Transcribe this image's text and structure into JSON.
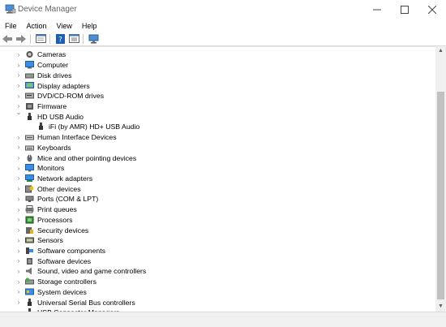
{
  "window": {
    "title": "Device Manager"
  },
  "menu": [
    "File",
    "Action",
    "View",
    "Help"
  ],
  "toolbar": {
    "buttons": [
      "back-arrow-icon",
      "forward-arrow-icon",
      "properties-icon",
      "help-icon",
      "update-driver-icon",
      "scan-hardware-icon"
    ]
  },
  "tree": {
    "items": [
      {
        "label": "Cameras",
        "icon": "camera-icon",
        "expanded": false
      },
      {
        "label": "Computer",
        "icon": "computer-icon",
        "expanded": false
      },
      {
        "label": "Disk drives",
        "icon": "disk-drive-icon",
        "expanded": false
      },
      {
        "label": "Display adapters",
        "icon": "display-adapter-icon",
        "expanded": false
      },
      {
        "label": "DVD/CD-ROM drives",
        "icon": "dvd-icon",
        "expanded": false
      },
      {
        "label": "Firmware",
        "icon": "firmware-icon",
        "expanded": false
      },
      {
        "label": "HD USB Audio",
        "icon": "usb-audio-icon",
        "expanded": true
      },
      {
        "label": "iFi (by AMR) HD+ USB Audio",
        "icon": "usb-plug-icon",
        "child": true
      },
      {
        "label": "Human Interface Devices",
        "icon": "hid-icon",
        "expanded": false
      },
      {
        "label": "Keyboards",
        "icon": "keyboard-icon",
        "expanded": false
      },
      {
        "label": "Mice and other pointing devices",
        "icon": "mouse-icon",
        "expanded": false
      },
      {
        "label": "Monitors",
        "icon": "monitor-icon",
        "expanded": false
      },
      {
        "label": "Network adapters",
        "icon": "network-icon",
        "expanded": false
      },
      {
        "label": "Other devices",
        "icon": "other-devices-icon",
        "expanded": false
      },
      {
        "label": "Ports (COM & LPT)",
        "icon": "port-icon",
        "expanded": false
      },
      {
        "label": "Print queues",
        "icon": "printer-icon",
        "expanded": false
      },
      {
        "label": "Processors",
        "icon": "processor-icon",
        "expanded": false
      },
      {
        "label": "Security devices",
        "icon": "security-device-icon",
        "expanded": false
      },
      {
        "label": "Sensors",
        "icon": "sensor-icon",
        "expanded": false
      },
      {
        "label": "Software components",
        "icon": "software-component-icon",
        "expanded": false
      },
      {
        "label": "Software devices",
        "icon": "software-device-icon",
        "expanded": false
      },
      {
        "label": "Sound, video and game controllers",
        "icon": "speaker-icon",
        "expanded": false
      },
      {
        "label": "Storage controllers",
        "icon": "storage-controller-icon",
        "expanded": false
      },
      {
        "label": "System devices",
        "icon": "system-device-icon",
        "expanded": false
      },
      {
        "label": "Universal Serial Bus controllers",
        "icon": "usb-controller-icon",
        "expanded": false
      },
      {
        "label": "USB Connector Managers",
        "icon": "usb-connector-icon",
        "expanded": false
      }
    ]
  },
  "colors": {
    "accent": "#1e7bd6"
  }
}
